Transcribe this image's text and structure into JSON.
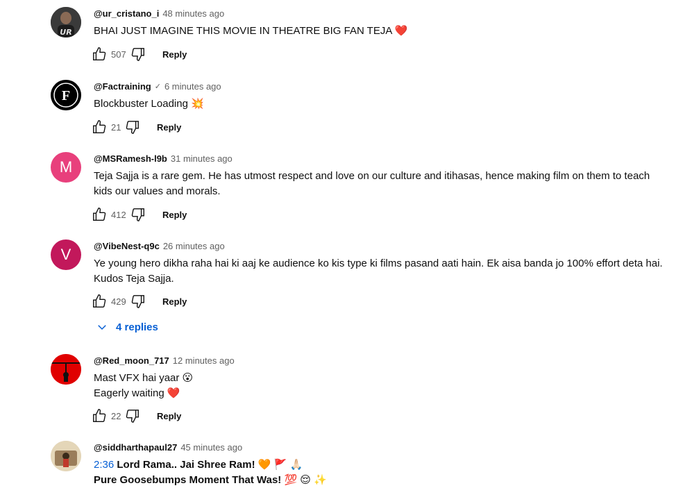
{
  "comments": [
    {
      "author": "@ur_cristano_i",
      "time": "48 minutes ago",
      "lines": [
        "BHAI JUST IMAGINE THIS MOVIE IN THEATRE BIG FAN TEJA  ❤️"
      ],
      "likes": "507",
      "reply_label": "Reply",
      "avatar_text": "UR"
    },
    {
      "author": "@Factraining",
      "verified": "✓",
      "time": "6 minutes ago",
      "lines": [
        "Blockbuster Loading 💥"
      ],
      "likes": "21",
      "reply_label": "Reply",
      "avatar_text": "F"
    },
    {
      "author": "@MSRamesh-l9b",
      "time": "31 minutes ago",
      "lines": [
        "Teja Sajja is a rare gem. He has utmost respect and love on our culture and itihasas, hence making film on them to teach",
        "kids our values and morals."
      ],
      "likes": "412",
      "reply_label": "Reply",
      "avatar_text": "M",
      "avatar_color": "#e8407c"
    },
    {
      "author": "@VibeNest-q9c",
      "time": "26 minutes ago",
      "lines": [
        "Ye young hero dikha raha hai ki aaj ke audience ko kis type ki films pasand aati hain. Ek aisa banda jo 100% effort deta hai.",
        "Kudos Teja Sajja."
      ],
      "likes": "429",
      "reply_label": "Reply",
      "replies_label": "4 replies",
      "avatar_text": "V",
      "avatar_color": "#c2185b"
    },
    {
      "author": "@Red_moon_717",
      "time": "12 minutes ago",
      "lines": [
        "Mast VFX hai yaar 😮",
        "Eagerly waiting ❤️"
      ],
      "likes": "22",
      "reply_label": "Reply"
    },
    {
      "author": "@siddharthapaul27",
      "time": "45 minutes ago",
      "timestamp_link": "2:36",
      "line1_rest": " Lord Rama.. Jai Shree Ram! 🧡 🚩 🙏🏻",
      "line2": "Pure Goosebumps Moment That Was! 💯 😌 ✨"
    }
  ],
  "colors": {
    "link": "#065fd4",
    "meta": "#606060",
    "text": "#0f0f0f"
  }
}
